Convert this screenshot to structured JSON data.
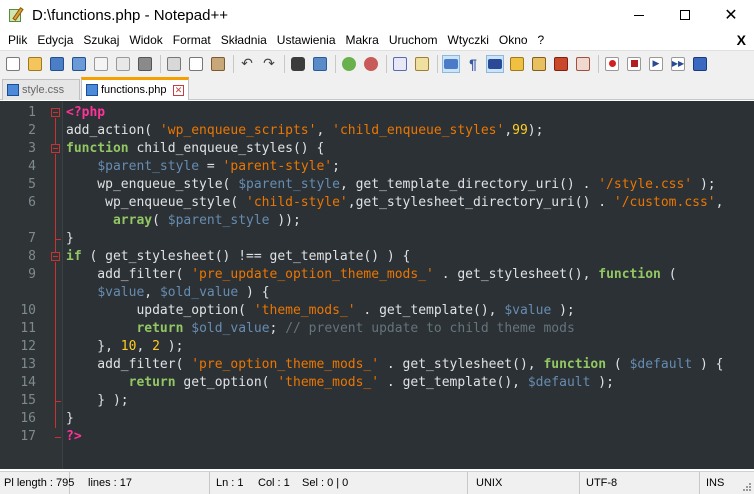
{
  "window": {
    "title": "D:\\functions.php - Notepad++"
  },
  "menu": {
    "items": [
      "Plik",
      "Edycja",
      "Szukaj",
      "Widok",
      "Format",
      "Składnia",
      "Ustawienia",
      "Makra",
      "Uruchom",
      "Wtyczki",
      "Okno",
      "?"
    ],
    "close_label": "X"
  },
  "toolbar": {
    "icons": [
      "new-file-icon",
      "open-file-icon",
      "save-icon",
      "save-all-icon",
      "close-icon",
      "close-all-icon",
      "print-icon",
      "cut-icon",
      "copy-icon",
      "paste-icon",
      "undo-icon",
      "redo-icon",
      "find-icon",
      "replace-icon",
      "zoom-in-icon",
      "zoom-out-icon",
      "sync-v-icon",
      "sync-h-icon",
      "wrap-icon",
      "all-chars-icon",
      "indent-guide-icon",
      "udl-icon",
      "doc-map-icon",
      "function-list-icon",
      "folder-workspace-icon",
      "record-macro-icon",
      "stop-macro-icon",
      "play-macro-icon",
      "run-macro-icon",
      "save-macro-icon"
    ]
  },
  "tabs": [
    {
      "label": "style.css",
      "active": false
    },
    {
      "label": "functions.php",
      "active": true
    }
  ],
  "editor": {
    "lines": [
      {
        "num": "1",
        "tokens": [
          {
            "t": "<?php",
            "c": "t-php"
          }
        ]
      },
      {
        "num": "2",
        "tokens": [
          {
            "t": "add_action( ",
            "c": "t-fn"
          },
          {
            "t": "'wp_enqueue_scripts'",
            "c": "t-str"
          },
          {
            "t": ", ",
            "c": "t-fn"
          },
          {
            "t": "'child_enqueue_styles'",
            "c": "t-str"
          },
          {
            "t": ",",
            "c": "t-fn"
          },
          {
            "t": "99",
            "c": "t-num"
          },
          {
            "t": ");",
            "c": "t-fn"
          }
        ]
      },
      {
        "num": "3",
        "tokens": [
          {
            "t": "function",
            "c": "t-kw"
          },
          {
            "t": " child_enqueue_styles() {",
            "c": "t-fn"
          }
        ]
      },
      {
        "num": "4",
        "tokens": [
          {
            "t": "    ",
            "c": "t-fn"
          },
          {
            "t": "$parent_style",
            "c": "t-var"
          },
          {
            "t": " = ",
            "c": "t-fn"
          },
          {
            "t": "'parent-style'",
            "c": "t-str"
          },
          {
            "t": ";",
            "c": "t-fn"
          }
        ]
      },
      {
        "num": "5",
        "tokens": [
          {
            "t": "    wp_enqueue_style( ",
            "c": "t-fn"
          },
          {
            "t": "$parent_style",
            "c": "t-var"
          },
          {
            "t": ", get_template_directory_uri() . ",
            "c": "t-fn"
          },
          {
            "t": "'/style.css'",
            "c": "t-str"
          },
          {
            "t": " );",
            "c": "t-fn"
          }
        ]
      },
      {
        "num": "6",
        "tokens": [
          {
            "t": "     wp_enqueue_style( ",
            "c": "t-fn"
          },
          {
            "t": "'child-style'",
            "c": "t-str"
          },
          {
            "t": ",get_stylesheet_directory_uri() . ",
            "c": "t-fn"
          },
          {
            "t": "'/custom.css'",
            "c": "t-str"
          },
          {
            "t": ",",
            "c": "t-fn"
          }
        ]
      },
      {
        "num": "",
        "tokens": [
          {
            "t": "      ",
            "c": "t-fn"
          },
          {
            "t": "array",
            "c": "t-kw"
          },
          {
            "t": "( ",
            "c": "t-fn"
          },
          {
            "t": "$parent_style",
            "c": "t-var"
          },
          {
            "t": " ));",
            "c": "t-fn"
          }
        ]
      },
      {
        "num": "7",
        "tokens": [
          {
            "t": "}",
            "c": "t-fn"
          }
        ]
      },
      {
        "num": "8",
        "tokens": [
          {
            "t": "if",
            "c": "t-kw"
          },
          {
            "t": " ( get_stylesheet() !== get_template() ) {",
            "c": "t-fn"
          }
        ]
      },
      {
        "num": "9",
        "tokens": [
          {
            "t": "    add_filter( ",
            "c": "t-fn"
          },
          {
            "t": "'pre_update_option_theme_mods_'",
            "c": "t-str"
          },
          {
            "t": " . get_stylesheet(), ",
            "c": "t-fn"
          },
          {
            "t": "function",
            "c": "t-kw"
          },
          {
            "t": " (",
            "c": "t-fn"
          }
        ]
      },
      {
        "num": "",
        "tokens": [
          {
            "t": "    ",
            "c": "t-fn"
          },
          {
            "t": "$value",
            "c": "t-var"
          },
          {
            "t": ", ",
            "c": "t-fn"
          },
          {
            "t": "$old_value",
            "c": "t-var"
          },
          {
            "t": " ) {",
            "c": "t-fn"
          }
        ]
      },
      {
        "num": "10",
        "tokens": [
          {
            "t": "         update_option( ",
            "c": "t-fn"
          },
          {
            "t": "'theme_mods_'",
            "c": "t-str"
          },
          {
            "t": " . get_template(), ",
            "c": "t-fn"
          },
          {
            "t": "$value",
            "c": "t-var"
          },
          {
            "t": " );",
            "c": "t-fn"
          }
        ]
      },
      {
        "num": "11",
        "tokens": [
          {
            "t": "         ",
            "c": "t-fn"
          },
          {
            "t": "return",
            "c": "t-kw"
          },
          {
            "t": " ",
            "c": "t-fn"
          },
          {
            "t": "$old_value",
            "c": "t-var"
          },
          {
            "t": "; ",
            "c": "t-fn"
          },
          {
            "t": "// prevent update to child theme mods",
            "c": "t-cm"
          }
        ]
      },
      {
        "num": "12",
        "tokens": [
          {
            "t": "    }, ",
            "c": "t-fn"
          },
          {
            "t": "10",
            "c": "t-num"
          },
          {
            "t": ", ",
            "c": "t-fn"
          },
          {
            "t": "2",
            "c": "t-num"
          },
          {
            "t": " );",
            "c": "t-fn"
          }
        ]
      },
      {
        "num": "13",
        "tokens": [
          {
            "t": "    add_filter( ",
            "c": "t-fn"
          },
          {
            "t": "'pre_option_theme_mods_'",
            "c": "t-str"
          },
          {
            "t": " . get_stylesheet(), ",
            "c": "t-fn"
          },
          {
            "t": "function",
            "c": "t-kw"
          },
          {
            "t": " ( ",
            "c": "t-fn"
          },
          {
            "t": "$default",
            "c": "t-var"
          },
          {
            "t": " ) {",
            "c": "t-fn"
          }
        ]
      },
      {
        "num": "14",
        "tokens": [
          {
            "t": "        ",
            "c": "t-fn"
          },
          {
            "t": "return",
            "c": "t-kw"
          },
          {
            "t": " get_option( ",
            "c": "t-fn"
          },
          {
            "t": "'theme_mods_'",
            "c": "t-str"
          },
          {
            "t": " . get_template(), ",
            "c": "t-fn"
          },
          {
            "t": "$default",
            "c": "t-var"
          },
          {
            "t": " );",
            "c": "t-fn"
          }
        ]
      },
      {
        "num": "15",
        "tokens": [
          {
            "t": "    } );",
            "c": "t-fn"
          }
        ]
      },
      {
        "num": "16",
        "tokens": [
          {
            "t": "}",
            "c": "t-fn"
          }
        ]
      },
      {
        "num": "17",
        "tokens": [
          {
            "t": "?>",
            "c": "t-php"
          }
        ]
      }
    ]
  },
  "status": {
    "length": "Pl length : 795",
    "lines": "lines : 17",
    "ln": "Ln : 1",
    "col": "Col : 1",
    "sel": "Sel : 0 | 0",
    "eol": "UNIX",
    "encoding": "UTF-8",
    "mode": "INS"
  },
  "colors": {
    "editor_bg": "#2b3135",
    "keyword": "#93c763",
    "variable": "#678cb1",
    "string": "#ec7600",
    "number": "#ffcd22",
    "comment": "#66747b",
    "php_tag": "#ff3399",
    "tab_accent": "#f5a000"
  }
}
